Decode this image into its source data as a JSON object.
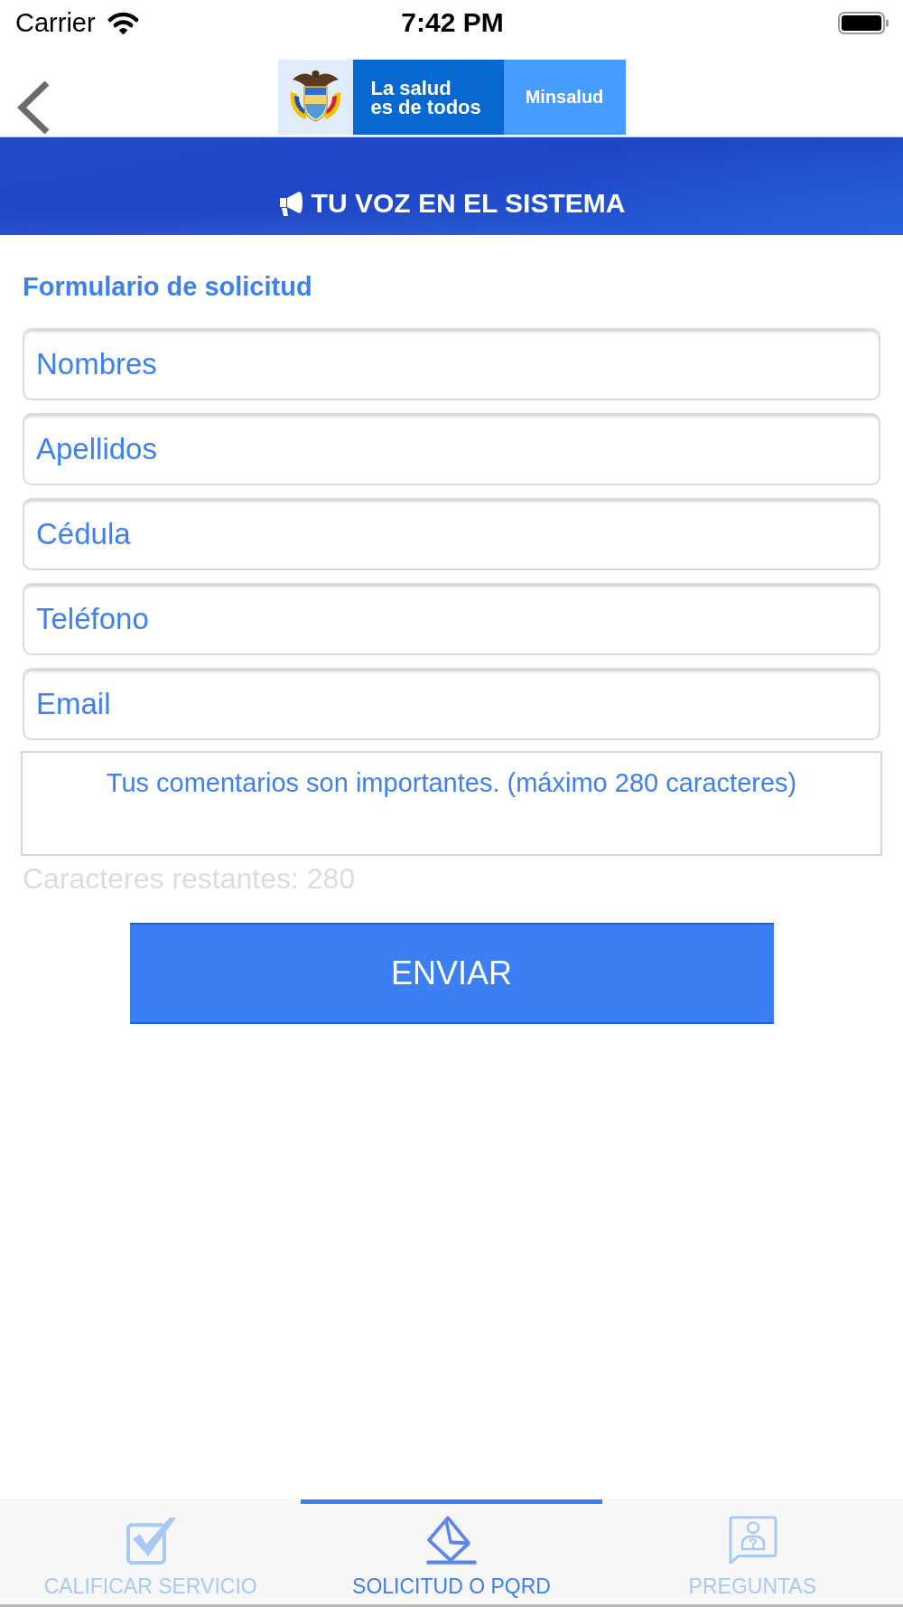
{
  "status_bar": {
    "carrier": "Carrier",
    "time": "7:42 PM"
  },
  "nav_bar": {
    "logo": {
      "slogan": "La salud\nes de todos",
      "brand": "Minsalud"
    }
  },
  "banner": {
    "title": "TU VOZ EN EL SISTEMA"
  },
  "form": {
    "title": "Formulario de solicitud",
    "fields": [
      {
        "placeholder": "Nombres"
      },
      {
        "placeholder": "Apellidos"
      },
      {
        "placeholder": "Cédula"
      },
      {
        "placeholder": "Teléfono"
      },
      {
        "placeholder": "Email"
      }
    ],
    "comments": {
      "placeholder": "Tus comentarios son importantes. (máximo 280 caracteres)"
    },
    "counter": "Caracteres restantes: 280",
    "submit": "ENVIAR"
  },
  "tab_bar": {
    "tabs": [
      {
        "kind": "checkbox",
        "label": "CALIFICAR SERVICIO",
        "selected": false
      },
      {
        "kind": "ballot",
        "label": "SOLICITUD O PQRD",
        "selected": true
      },
      {
        "kind": "question",
        "label": "PREGUNTAS",
        "selected": false
      }
    ]
  }
}
